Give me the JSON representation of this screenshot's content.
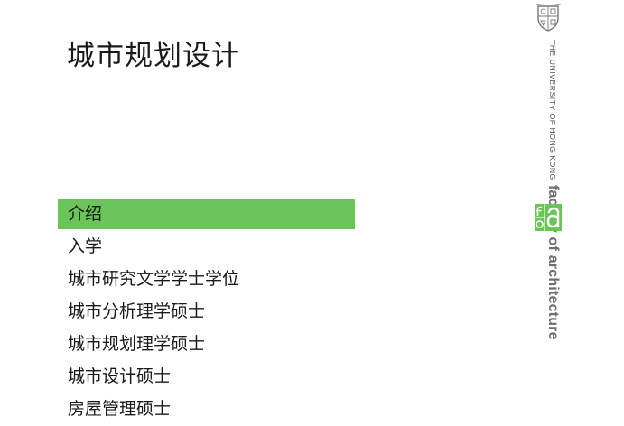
{
  "header": {
    "title": "城市规划设计"
  },
  "nav": {
    "items": [
      {
        "label": "介绍",
        "active": true
      },
      {
        "label": "入学",
        "active": false
      },
      {
        "label": "城市研究文学学士学位",
        "active": false
      },
      {
        "label": "城市分析理学硕士",
        "active": false
      },
      {
        "label": "城市规划理学硕士",
        "active": false
      },
      {
        "label": "城市设计硕士",
        "active": false
      },
      {
        "label": "房屋管理硕士",
        "active": false
      }
    ]
  },
  "logo": {
    "university": "THE UNIVERSITY OF HONG KONG",
    "faculty": "faculty of architecture",
    "crest_icon": "hku-crest-icon",
    "mark_icon": "fa-logo-mark-icon"
  },
  "colors": {
    "accent_green": "#6bc45a",
    "logo_gray": "#6e6e6e",
    "text": "#1a1a1a"
  }
}
